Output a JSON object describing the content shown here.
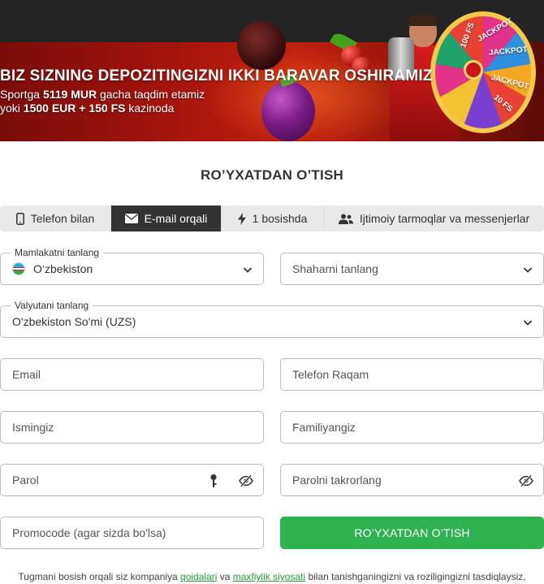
{
  "banner": {
    "title": "BIZ SIZNING DEPOZITINGIZNI IKKI BARAVAR OSHIRAMIZ",
    "line1_prefix": "Sportga ",
    "line1_bold": "5119 MUR",
    "line1_suffix": " gacha taqdim etamiz",
    "line2_prefix": "yoki ",
    "line2_bold": "1500 EUR + 150 FS",
    "line2_suffix": " kazinoda",
    "wheel_labels": [
      "100 FS",
      "JACKPOT",
      "JACKPOT",
      "JACKPOT",
      "10 FS"
    ]
  },
  "form": {
    "title": "RO’YXATDAN O’TISH",
    "tabs": [
      {
        "label": "Telefon bilan",
        "icon": "phone-icon",
        "active": false
      },
      {
        "label": "E-mail orqali",
        "icon": "envelope-icon",
        "active": true
      },
      {
        "label": "1 bosishda",
        "icon": "lightning-icon",
        "active": false
      },
      {
        "label": "Ijtimoiy tarmoqlar va messenjerlar",
        "icon": "users-icon",
        "active": false
      }
    ],
    "country": {
      "label": "Mamlakatni tanlang",
      "value": "O‘zbekiston"
    },
    "city": {
      "placeholder": "Shaharni tanlang"
    },
    "currency": {
      "label": "Valyutani tanlang",
      "value": "O'zbekiston So'mi (UZS)"
    },
    "email": {
      "placeholder": "Email"
    },
    "phone": {
      "placeholder": "Telefon Raqam"
    },
    "first_name": {
      "placeholder": "Ismingiz"
    },
    "last_name": {
      "placeholder": "Familiyangiz"
    },
    "password": {
      "placeholder": "Parol"
    },
    "password_repeat": {
      "placeholder": "Parolni takrorlang"
    },
    "promocode": {
      "placeholder": "Promocode (agar sizda bo'lsa)"
    },
    "submit_label": "RO’YXATDAN O’TISH"
  },
  "terms": {
    "prefix": "Tugmani bosish orqali siz kompaniya ",
    "link1": "qoidalari",
    "middle": " va ",
    "link2": "maxfiylik siyosati",
    "suffix": " bilan tanishganingizni va roziligingizni tasdiqlaysiz,"
  },
  "colors": {
    "accent": "#2fb351",
    "tab_active": "#333333",
    "link": "#2a9a3f"
  }
}
